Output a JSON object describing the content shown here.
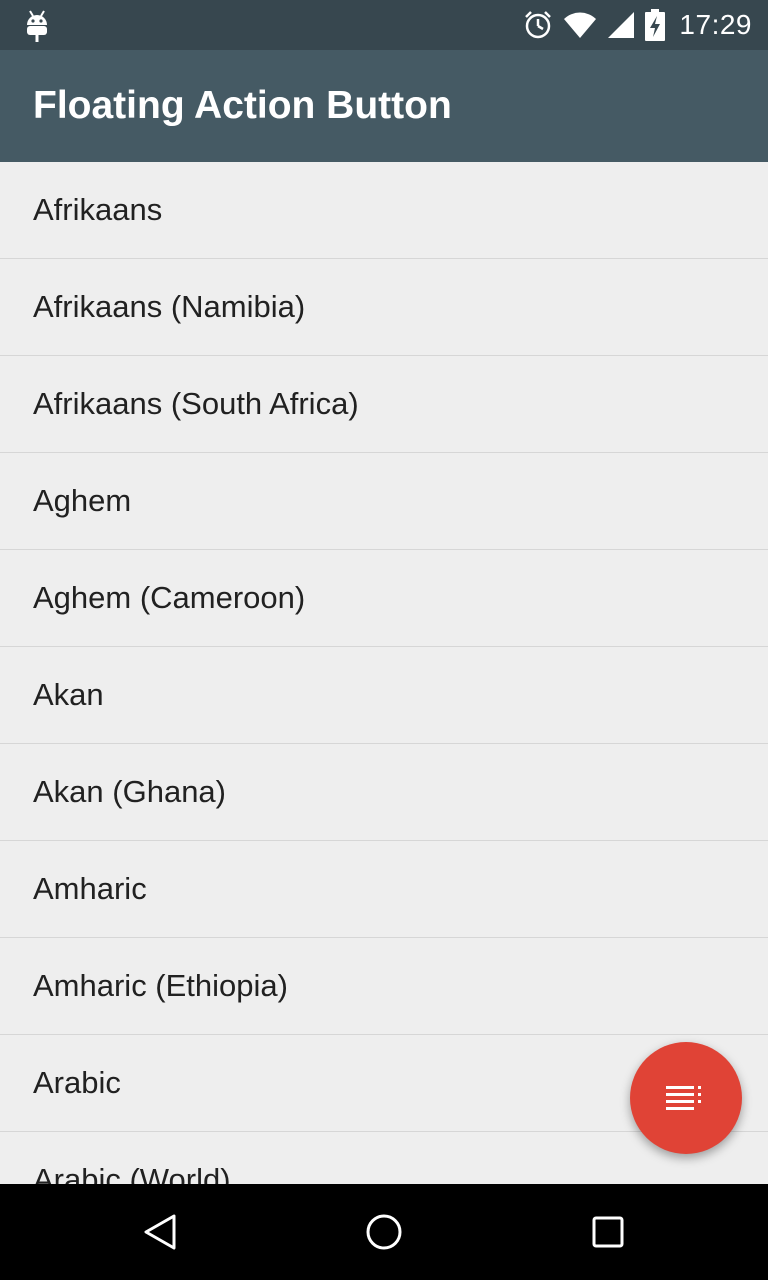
{
  "status_bar": {
    "time": "17:29",
    "icons": [
      "android-debug-icon",
      "alarm-icon",
      "wifi-icon",
      "cellular-signal-icon",
      "battery-charging-icon"
    ]
  },
  "app_bar": {
    "title": "Floating Action Button"
  },
  "list": {
    "items": [
      "Afrikaans",
      "Afrikaans (Namibia)",
      "Afrikaans (South Africa)",
      "Aghem",
      "Aghem (Cameroon)",
      "Akan",
      "Akan (Ghana)",
      "Amharic",
      "Amharic (Ethiopia)",
      "Arabic",
      "Arabic (World)"
    ]
  },
  "fab": {
    "icon": "sort-list-icon",
    "color": "#e04336"
  },
  "nav_bar": {
    "buttons": [
      "back-icon",
      "home-icon",
      "recents-icon"
    ]
  },
  "colors": {
    "status_bar": "#37474f",
    "app_bar": "#455a64",
    "background": "#eeeeee"
  }
}
